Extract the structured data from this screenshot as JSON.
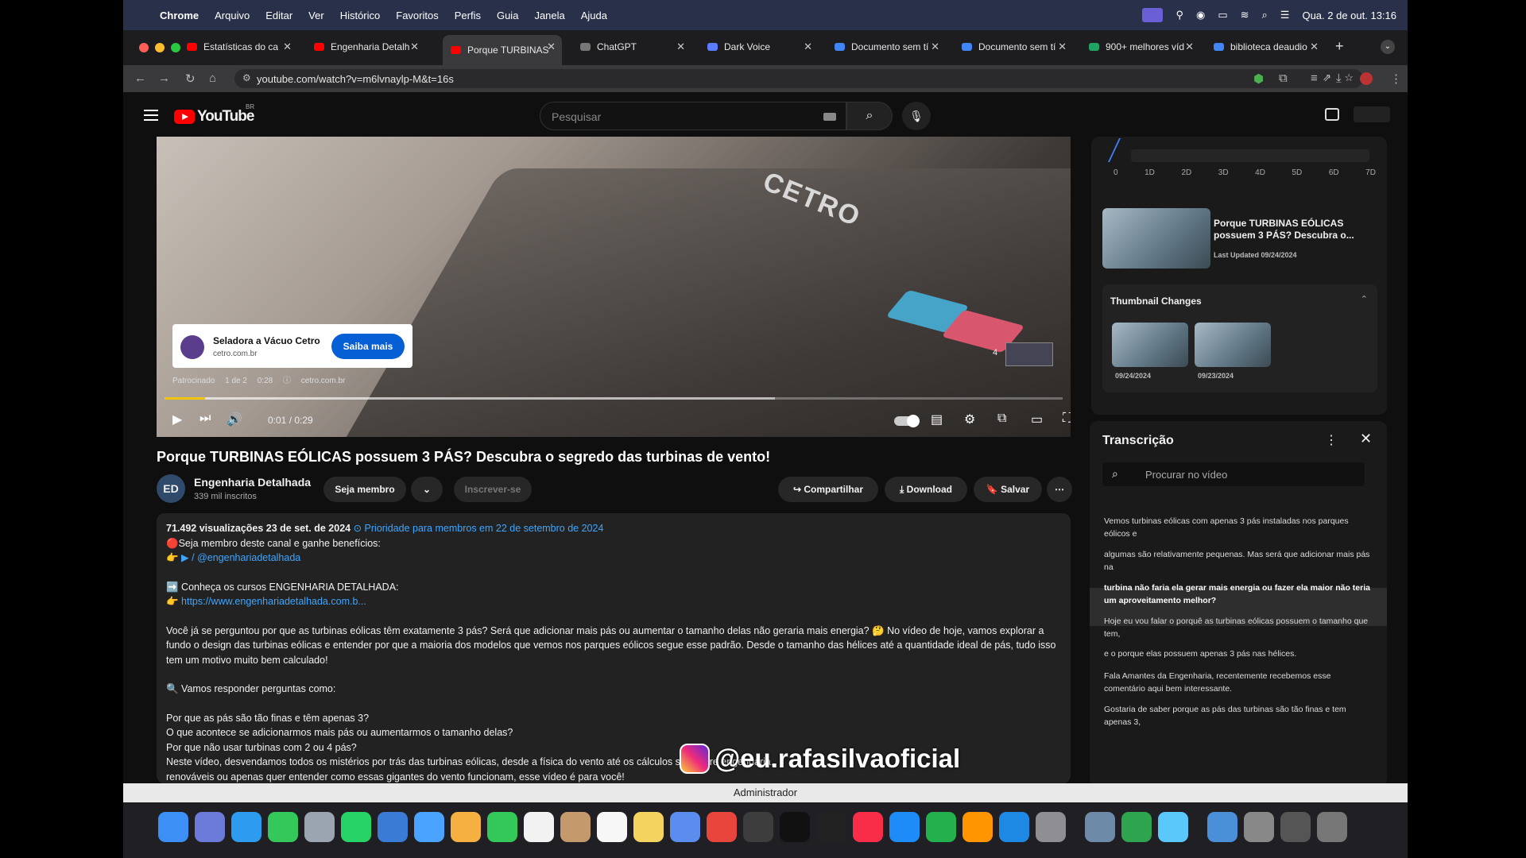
{
  "menubar": {
    "app": "Chrome",
    "items": [
      "Arquivo",
      "Editar",
      "Ver",
      "Histórico",
      "Favoritos",
      "Perfis",
      "Guia",
      "Janela",
      "Ajuda"
    ],
    "clock": "Qua. 2 de out.  13:16"
  },
  "tabs": [
    {
      "label": "Estatísticas do ca",
      "color": "#ff0000"
    },
    {
      "label": "Engenharia Detalh",
      "color": "#ff0000"
    },
    {
      "label": "Porque TURBINAS",
      "color": "#ff0000",
      "active": true
    },
    {
      "label": "ChatGPT",
      "color": "#777777"
    },
    {
      "label": "Dark Voice",
      "color": "#5b7cff"
    },
    {
      "label": "Documento sem tí",
      "color": "#4285f4"
    },
    {
      "label": "Documento sem tí",
      "color": "#4285f4"
    },
    {
      "label": "900+ melhores víd",
      "color": "#1fa463"
    },
    {
      "label": "biblioteca deaudio",
      "color": "#4285f4"
    }
  ],
  "address": {
    "url": "youtube.com/watch?v=m6lvnaylp-M&t=16s"
  },
  "youtube": {
    "logo_text": "YouTube",
    "region": "BR",
    "search_placeholder": "Pesquisar"
  },
  "player": {
    "brand_text": "CETRO",
    "ad_name": "Seladora a Vácuo Cetro",
    "ad_domain": "cetro.com.br",
    "ad_button": "Saiba mais",
    "sponsored": "Patrocinado",
    "ad_index": "1 de 2",
    "ad_time": "0:28",
    "ad_site": "cetro.com.br",
    "ad_queue": "4",
    "time": "0:01 / 0:29",
    "progress_fraction": 0.045
  },
  "video": {
    "title": "Porque TURBINAS EÓLICAS possuem 3 PÁS? Descubra o segredo das turbinas de vento!",
    "channel": "Engenharia Detalhada",
    "subscribers": "339 mil inscritos",
    "member_button": "Seja membro",
    "subscribe_button": "Inscrever-se",
    "share": "Compartilhar",
    "download": "Download",
    "save": "Salvar",
    "channel_initials": "ED"
  },
  "description": {
    "stats": "71.492 visualizações  23 de set. de 2024",
    "priority": "⊙ Prioridade para membros em 22 de setembro de 2024",
    "lines": [
      "🔴Seja membro deste canal e ganhe benefícios:",
      "👉 ▶ / @engenhariadetalhada",
      "",
      "➡️ Conheça os cursos ENGENHARIA DETALHADA:",
      "👉 https://www.engenhariadetalhada.com.b...",
      "",
      "Você já se perguntou por que as turbinas eólicas têm exatamente 3 pás? Será que adicionar mais pás ou aumentar o tamanho delas não geraria mais energia? 🤔 No vídeo de hoje, vamos explorar a",
      "fundo o design das turbinas eólicas e entender por que a maioria dos modelos que vemos nos parques eólicos segue esse padrão. Desde o tamanho das hélices até a quantidade ideal de pás, tudo isso",
      "tem um motivo muito bem calculado!",
      "",
      "🔍 Vamos responder perguntas como:",
      "",
      "Por que as pás são tão finas e têm apenas 3?",
      "O que acontece se adicionarmos mais pás ou aumentarmos o tamanho delas?",
      "Por que não usar turbinas com 2 ou 4 pás?",
      "Neste vídeo, desvendamos todos os mistérios por trás das turbinas eólicas, desde a física do vento até os cálculos                                                              sso sobre engenharia,",
      "renováveis ou apenas quer entender como essas gigantes do vento funcionam, esse vídeo é para você!"
    ]
  },
  "side": {
    "axis_ticks": [
      "0",
      "1D",
      "2D",
      "3D",
      "4D",
      "5D",
      "6D",
      "7D"
    ],
    "latest_title": "Porque TURBINAS EÓLICAS possuem 3 PÁS? Descubra o...",
    "last_updated": "Last Updated 09/24/2024",
    "thumb_header": "Thumbnail Changes",
    "thumb_dates": [
      "09/24/2024",
      "09/23/2024"
    ]
  },
  "transcript": {
    "title": "Transcrição",
    "search_placeholder": "Procurar no vídeo",
    "segments": [
      "Vemos turbinas eólicas com apenas 3  pás instaladas nos parques eólicos e",
      "algumas são relativamente pequenas. Mas será que adicionar mais pás na",
      "turbina não faria ela gerar mais energia ou fazer  ela maior não teria um aproveitamento melhor?",
      "Hoje eu vou falar o porquê as turbinas  eólicas possuem o tamanho que tem,",
      "e o porque elas possuem apenas 3 pás nas hélices.",
      "Fala Amantes da Engenharia, recentemente  recebemos esse comentário aqui bem interessante.",
      "Gostaria de saber porque as pás das  turbinas são tão finas e tem apenas 3,"
    ]
  },
  "watermark": "@eu.rafasilvaoficial",
  "admin_bar": "Administrador"
}
